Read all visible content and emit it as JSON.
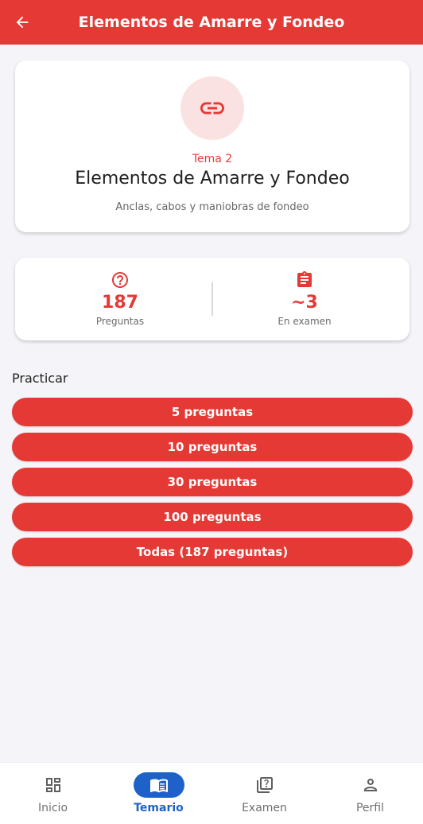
{
  "appbar": {
    "title": "Elementos de Amarre y Fondeo"
  },
  "topic": {
    "icon": "link-icon",
    "number_label": "Tema 2",
    "title": "Elementos de Amarre y Fondeo",
    "subtitle": "Anclas, cabos y maniobras de fondeo"
  },
  "stats": {
    "questions": {
      "value": "187",
      "label": "Preguntas",
      "icon": "help-circle-icon"
    },
    "exam": {
      "value": "~3",
      "label": "En examen",
      "icon": "clipboard-icon"
    }
  },
  "practice": {
    "title": "Practicar",
    "buttons": [
      {
        "label": "5 preguntas"
      },
      {
        "label": "10 preguntas"
      },
      {
        "label": "30 preguntas"
      },
      {
        "label": "100 preguntas"
      },
      {
        "label": "Todas (187 preguntas)"
      }
    ]
  },
  "bottom_nav": {
    "items": [
      {
        "label": "Inicio",
        "icon": "dashboard-icon",
        "active": false
      },
      {
        "label": "Temario",
        "icon": "book-icon",
        "active": true
      },
      {
        "label": "Examen",
        "icon": "quiz-icon",
        "active": false
      },
      {
        "label": "Perfil",
        "icon": "person-icon",
        "active": false
      }
    ]
  },
  "colors": {
    "primary": "#e53935",
    "accent": "#1e62c9",
    "background": "#f5f5f9"
  }
}
